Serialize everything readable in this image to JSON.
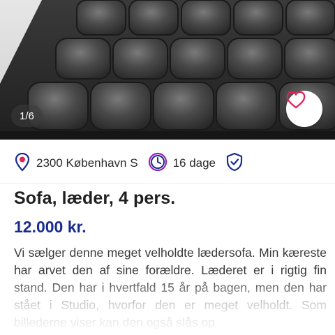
{
  "gallery": {
    "counter": "1/6",
    "favorite_icon": "heart-outline-icon",
    "photo_alt": "Sofa, læder"
  },
  "meta": {
    "location": "2300 København S",
    "location_icon": "location-pin-icon",
    "age": "16 dage",
    "age_icon": "clock-icon",
    "verified_icon": "shield-check-icon"
  },
  "listing": {
    "title": "Sofa, læder, 4 pers.",
    "price": "12.000 kr.",
    "description": "Vi sælger denne meget velholdte lædersofa. Min kæreste har arvet den af sine forældre. Læderet er i rigtig fin stand. Den har i hvertfald 15 år på bagen, men den har stået i Studio, hvorfor den er meget velholdt. Som billederne viser kan den også slås op"
  },
  "colors": {
    "accent": "#1a2b8f",
    "favorite": "#e0245e",
    "pin": "#e0245e",
    "icon_stroke": "#1a2b8f"
  }
}
